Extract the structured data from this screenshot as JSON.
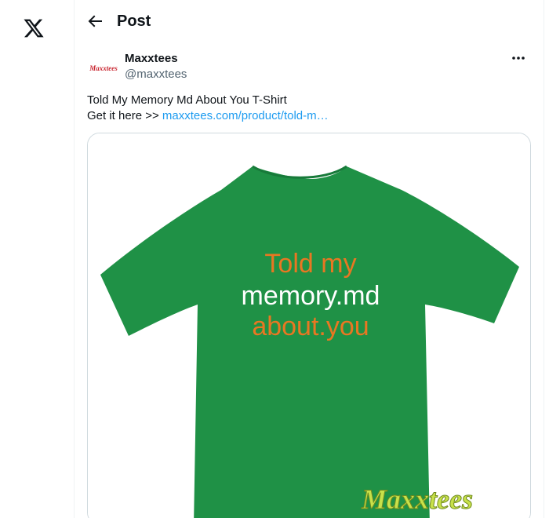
{
  "nav": {
    "logo_icon": "x-logo-icon"
  },
  "header": {
    "back_icon": "arrow-left-icon",
    "title": "Post"
  },
  "post": {
    "author": {
      "display_name": "Maxxtees",
      "handle": "@maxxtees",
      "avatar_text": "Maxxtees"
    },
    "more_icon": "more-horizontal-icon",
    "text_line1": "Told My Memory Md About You T-Shirt",
    "text_line2_prefix": "Get it here >> ",
    "link_text": "maxxtees.com/product/told-m…",
    "media": {
      "shirt_color": "#1f9146",
      "shirt_text_line1": "Told my",
      "shirt_text_line2": "memory.md",
      "shirt_text_line3": "about.you",
      "text_orange": "#e87722",
      "text_white": "#ffffff",
      "watermark": "Maxxtees"
    }
  },
  "colors": {
    "link": "#1d9bf0",
    "border": "#cfd9de",
    "secondary_text": "#536471"
  }
}
